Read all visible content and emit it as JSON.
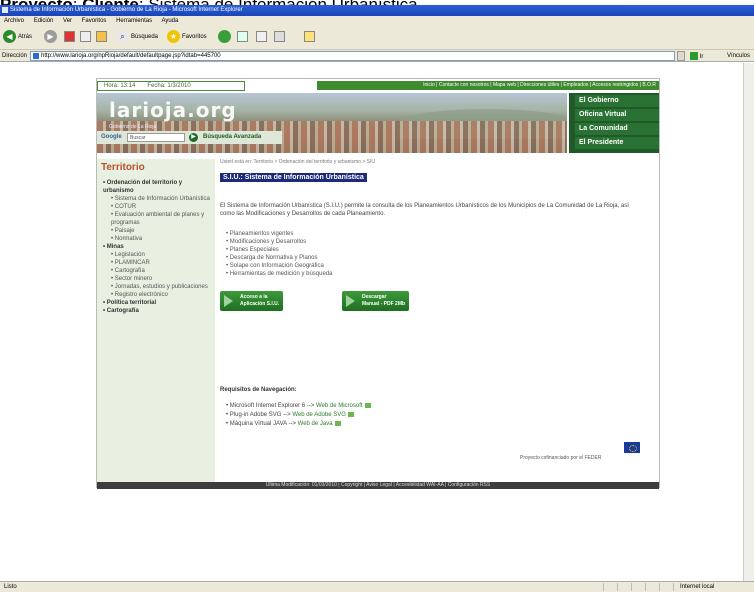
{
  "caption": {
    "prefix": "Proyecto",
    "sep": ": ",
    "client": "Cliente",
    "rest": ": Sistema de Información Urbanística"
  },
  "browser": {
    "title": "Sistema de Información Urbanística - Gobierno de La Rioja - Microsoft Internet Explorer",
    "menu": [
      "Archivo",
      "Edición",
      "Ver",
      "Favoritos",
      "Herramientas",
      "Ayuda"
    ],
    "toolbar": {
      "back": "Atrás",
      "search": "Búsqueda",
      "favorites": "Favoritos"
    },
    "address_label": "Dirección",
    "address": "http://www.larioja.org/npRioja/default/defaultpage.jsp?idtab=445700",
    "go": "Ir",
    "links": "Vínculos",
    "status_left": "Listo",
    "status_right": "Internet local"
  },
  "site": {
    "time_label": "Hora: 13:14",
    "date_label": "Fecha: 1/3/2010",
    "top_links": "Inicio | Contacte con nosotros | Mapa web | Direcciones útiles | Empleados | Accesos restringidos | B.O.R",
    "logo": "larioja.org",
    "logo_sub": "Gobierno de La Rioja",
    "right_nav": [
      "El Gobierno",
      "Oficina Virtual",
      "La Comunidad",
      "El Presidente"
    ],
    "google": "Google",
    "search_placeholder": "Buscar",
    "advanced": "Búsqueda Avanzada"
  },
  "sidebar": {
    "title": "Territorio",
    "items": [
      {
        "text": "• Ordenación del territorio y urbanismo",
        "level": 1
      },
      {
        "text": "• Sistema de Información Urbanística",
        "level": 2
      },
      {
        "text": "• COTUR",
        "level": 2
      },
      {
        "text": "• Evaluación ambiental de planes y programas",
        "level": 2
      },
      {
        "text": "• Paisaje",
        "level": 2
      },
      {
        "text": "• Normativa",
        "level": 2
      },
      {
        "text": "• Minas",
        "level": 1
      },
      {
        "text": "• Legislación",
        "level": 2
      },
      {
        "text": "• PLAMINCAR",
        "level": 2
      },
      {
        "text": "• Cartografía",
        "level": 2
      },
      {
        "text": "• Sector minero",
        "level": 2
      },
      {
        "text": "• Jornadas, estudios y publicaciones",
        "level": 2
      },
      {
        "text": "• Registro electrónico",
        "level": 2
      },
      {
        "text": "• Política territorial",
        "level": 1
      },
      {
        "text": "• Cartografía",
        "level": 1
      }
    ]
  },
  "main": {
    "breadcrumb": "Usted está en: Territorio > Ordenación del territorio y urbanismo > SIU",
    "title": "S.I.U.: Sistema de Información Urbanística",
    "intro": "El Sistema de Información Urbanística (S.I.U.) permite la consulta de los Planeamientos Urbanísticos de los Municipios de La Comunidad de La Rioja, así como las Modificaciones y Desarrollos de cada Planeamiento.",
    "features": [
      "• Planeamientos vigentes",
      "• Modificaciones y Desarrollos",
      "• Planes Especiales",
      "• Descarga de Normativa y Planos",
      "• Solape con Información Geográfica",
      "• Herramientas de medición y búsqueda"
    ],
    "btn_access": [
      "Acceso a la",
      "Aplicación S.I.U."
    ],
    "btn_download": [
      "Descargar",
      "Manual - PDF 2Mb"
    ],
    "req_title": "Requisitos de Navegación:",
    "reqs": [
      {
        "text": "• Microsoft Internet Explorer 6 --> ",
        "link": "Web de Microsoft"
      },
      {
        "text": "• Plug-in Adobe SVG --> ",
        "link": "Web de Adobe SVG"
      },
      {
        "text": "• Máquina Virtual JAVA --> ",
        "link": "Web de Java"
      }
    ],
    "eu_text": "Proyecto cofinanciado por el FEDER",
    "footer": "Última Modificación: 01/03/2010 | Copyright | Aviso Legal | Accesibilidad WAI-AA | Configuración RSS"
  },
  "colors": {
    "accent": "#3e8a2f",
    "title_bg": "#1d2a7a",
    "sidebar_title": "#b8502a"
  },
  "icons": [
    "back-icon",
    "forward-icon",
    "stop-icon",
    "refresh-icon",
    "home-icon",
    "search-icon",
    "favorites-icon",
    "media-icon",
    "history-icon",
    "mail-icon",
    "print-icon",
    "edit-icon"
  ]
}
